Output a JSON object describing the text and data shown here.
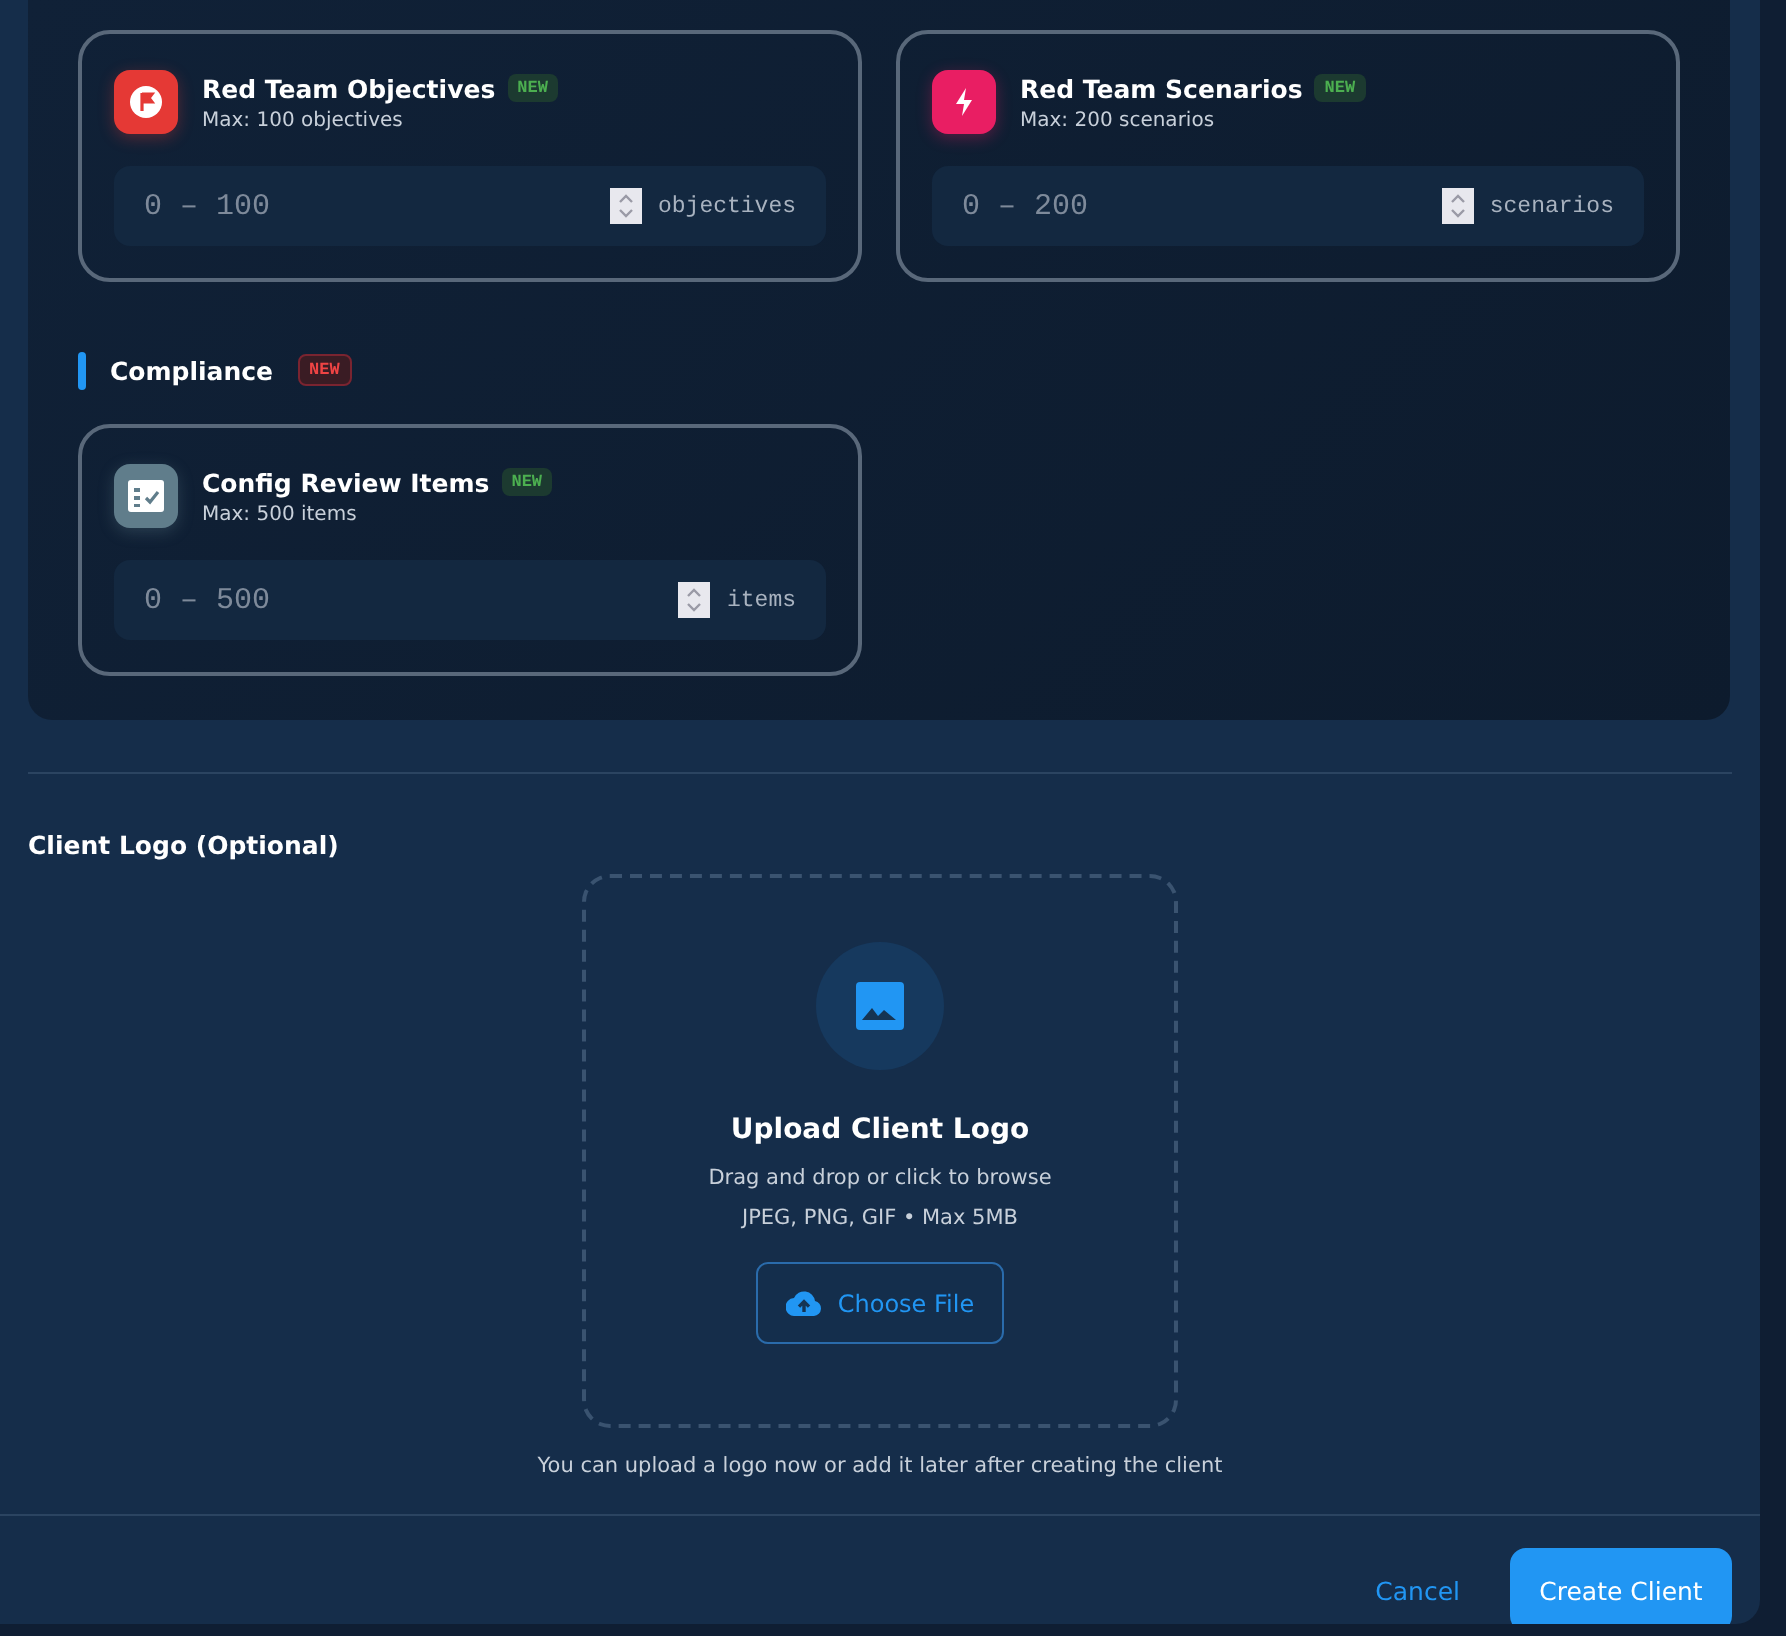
{
  "sections": [
    {
      "cards": [
        {
          "kind": "flag",
          "color": "#e53935",
          "title": "Red Team Objectives",
          "badge": "NEW",
          "subtitle": "Max: 100 objectives",
          "placeholder": "0 – 100",
          "unit": "objectives"
        },
        {
          "kind": "bolt",
          "color": "#e91e63",
          "title": "Red Team Scenarios",
          "badge": "NEW",
          "subtitle": "Max: 200 scenarios",
          "placeholder": "0 – 200",
          "unit": "scenarios"
        }
      ]
    },
    {
      "heading": "Compliance",
      "badge": "NEW",
      "cards": [
        {
          "kind": "checklist",
          "color": "#607d8b",
          "title": "Config Review Items",
          "badge": "NEW",
          "subtitle": "Max: 500 items",
          "placeholder": "0 – 500",
          "unit": "items"
        }
      ]
    }
  ],
  "logo": {
    "label": "Client Logo (Optional)",
    "title": "Upload Client Logo",
    "hint": "Drag and drop or click to browse",
    "formats": "JPEG, PNG, GIF • Max 5MB",
    "button": "Choose File",
    "note": "You can upload a logo now or add it later after creating the client"
  },
  "footer": {
    "cancel": "Cancel",
    "submit": "Create Client"
  }
}
